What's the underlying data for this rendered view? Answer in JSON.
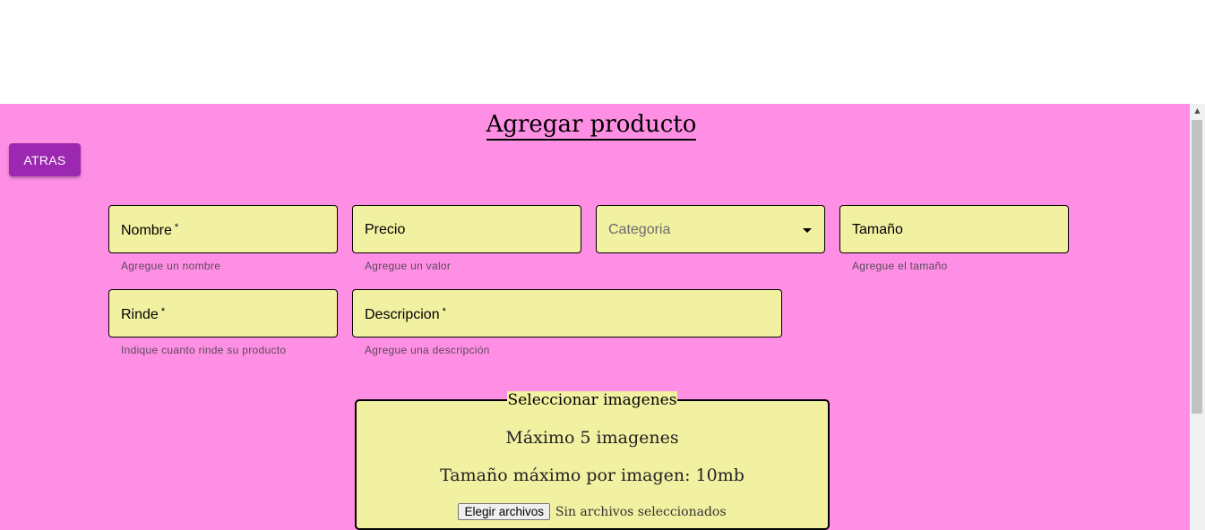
{
  "header": {
    "title": "Agregar producto"
  },
  "back_button": {
    "label": "ATRAS"
  },
  "form": {
    "nombre": {
      "label": "Nombre",
      "required": "*",
      "helper": "Agregue un nombre"
    },
    "precio": {
      "label": "Precio",
      "helper": "Agregue un valor"
    },
    "categoria": {
      "placeholder": "Categoria"
    },
    "tamano": {
      "label": "Tamaño",
      "helper": "Agregue el tamaño"
    },
    "rinde": {
      "label": "Rinde",
      "required": "*",
      "helper": "Indique cuanto rinde su producto"
    },
    "descripcion": {
      "label": "Descripcion",
      "required": "*",
      "helper": "Agregue una descripción"
    }
  },
  "images": {
    "legend": "Seleccionar imagenes",
    "max_count": "Máximo 5 imagenes",
    "max_size": "Tamaño máximo por imagen: 10mb",
    "file_button": "Elegir archivos",
    "file_status": "Sin archivos seleccionados"
  },
  "colors": {
    "background": "#ff8fe4",
    "field_background": "#f2f0a1",
    "accent_button": "#9c27b0"
  },
  "icons": [
    "dropdown-caret-icon",
    "scroll-up-arrow-icon"
  ]
}
